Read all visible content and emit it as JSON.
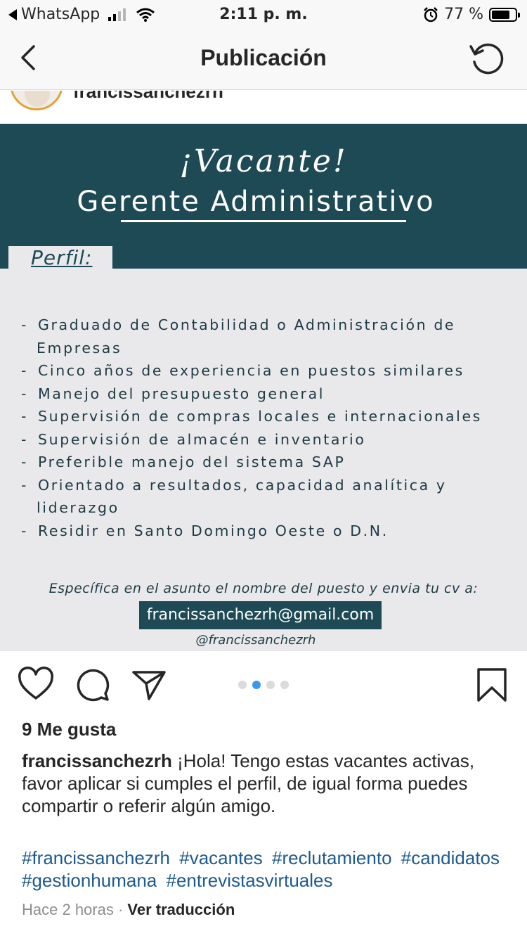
{
  "status_bar": {
    "back_app": "WhatsApp",
    "time": "2:11 p. m.",
    "battery": "77 %",
    "battery_level": 0.77
  },
  "nav": {
    "title": "Publicación",
    "back_icon": "chevron-left-icon",
    "refresh_icon": "refresh-icon"
  },
  "post": {
    "username": "francissanchezrh",
    "image": {
      "title": "¡Vacante!",
      "subtitle": "Gerente Administrativo",
      "section_label": "Perfil:",
      "requirements": [
        {
          "line": "Graduado de Contabilidad o Administración de",
          "cont": "Empresas"
        },
        {
          "line": "Cinco años de experiencia en puestos similares"
        },
        {
          "line": "Manejo del presupuesto general"
        },
        {
          "line": "Supervisión de compras locales e internacionales"
        },
        {
          "line": "Supervisión de almacén e inventario"
        },
        {
          "line": "Preferible manejo del sistema SAP"
        },
        {
          "line": "Orientado a resultados, capacidad analítica y",
          "cont": "liderazgo"
        },
        {
          "line": "Residir en Santo Domingo Oeste o D.N."
        }
      ],
      "apply_note": "Específica en el asunto el nombre del puesto y envia tu cv a:",
      "email": "francissanchezrh@gmail.com",
      "handle": "@francissanchezrh",
      "colors": {
        "banner": "#1e4a55",
        "background": "#e9e9ec"
      }
    },
    "carousel": {
      "count": 4,
      "active_index": 1
    },
    "likes": "9 Me gusta",
    "caption_user": "francissanchezrh",
    "caption_text": " ¡Hola! Tengo estas vacantes activas, favor aplicar si cumples el perfil, de igual forma puedes compartir o referir algún amigo.",
    "hashtags": [
      "#francissanchezrh",
      "#vacantes",
      "#reclutamiento",
      "#candidatos",
      "#gestionhumana",
      "#entrevistasvirtuales"
    ],
    "time_ago": "Hace 2 horas",
    "separator": " · ",
    "translate": "Ver traducción"
  }
}
